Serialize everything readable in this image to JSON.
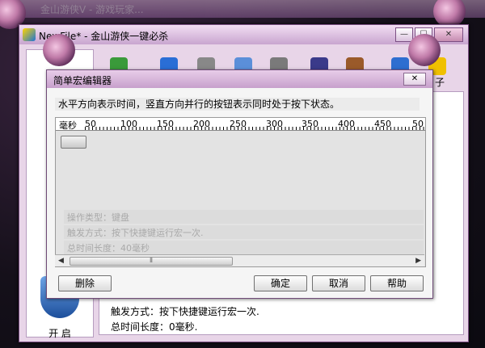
{
  "background_window": {
    "title": "金山游侠V - 游戏玩家..."
  },
  "main_window": {
    "title": "NewFile* - 金山游侠一键必杀",
    "toolbar_partial_label": "子",
    "start_label": "开 启",
    "info_lines": [
      "触发方式：按下快捷键运行宏一次.",
      "总时间长度：0毫秒."
    ]
  },
  "dialog": {
    "title": "简单宏编辑器",
    "hint": "水平方向表示时间，竖直方向并行的按钮表示同时处于按下状态。",
    "ruler": {
      "unit": "毫秒",
      "ticks": [
        "50",
        "100",
        "150",
        "200",
        "250",
        "300",
        "350",
        "400",
        "450",
        "50"
      ]
    },
    "info": {
      "op_type": "操作类型：键盘",
      "trigger": "触发方式：按下快捷键运行宏一次.",
      "duration": "总时间长度：40毫秒"
    },
    "scroll_thumb_grip": "⦀",
    "buttons": {
      "delete": "删除",
      "ok": "确定",
      "cancel": "取消",
      "help": "帮助"
    }
  },
  "window_buttons": {
    "minimize": "—",
    "maximize": "☐",
    "close": "✕"
  }
}
